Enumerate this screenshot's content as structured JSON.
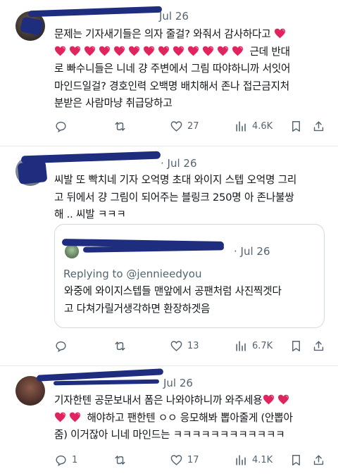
{
  "tweets": [
    {
      "timestamp": "Jul 26",
      "text_a": "문제는 기자새기들은 의자 줄걸? 와줘서 감사하다고",
      "text_b": "근데 반대",
      "text_c": "로 빠수니들은 니네 걍 주변에서 그림 따야하니까 서잇어\n마인드일걸? 경호인력 오백명 배치해서 존나 접근금지처\n분받은 사람마냥 취급당하고",
      "stats": {
        "replies": "",
        "retweets": "",
        "likes": "27",
        "views": "4.6K"
      }
    },
    {
      "timestamp": "· Jul 26",
      "text": "씨발 또 빡치네 기자 오억명 초대 와이지 스텝 오억명 그리\n고 뒤에서 걍 그림이 되어주는 블링크 250명 아 존나불쌍\n해 .. 씨발 ㅋㅋㅋ",
      "quote": {
        "timestamp": "· Jul 26",
        "replying_to": "Replying to @jennieedyou",
        "text": "와중에 와이지스텝들 맨앞에서 공팬처럼 사진찍겟다\n고 다쳐가릴거생각하면 환장하겟음"
      },
      "stats": {
        "replies": "",
        "retweets": "",
        "likes": "13",
        "views": "6.7K"
      }
    },
    {
      "timestamp": "Jul 26",
      "text_a": "기자한텐 공문보내서 폼은 나와야하니까 와주세용",
      "text_b": "해야하고 팬한텐 ㅇㅇ 응모해봐 뽑아줄게 (안뽑아",
      "text_c": "줌) 이거잖아 니네 마인드는 ㅋㅋㅋㅋㅋㅋㅋㅋㅋㅋㅋㅋ",
      "stats": {
        "replies": "1",
        "retweets": "",
        "likes": "17",
        "views": "4.1K"
      }
    }
  ],
  "colors": {
    "text": "#0f1419",
    "muted": "#536471",
    "heart": "#e0245e",
    "scribble": "#1e2d7d",
    "border": "#cfd9de"
  },
  "icons": [
    "reply-icon",
    "retweet-icon",
    "like-icon",
    "views-icon",
    "bookmark-icon",
    "share-icon"
  ]
}
